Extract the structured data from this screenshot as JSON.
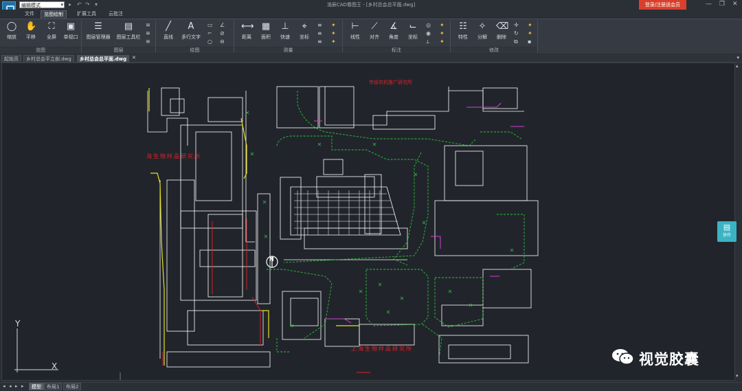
{
  "titlebar": {
    "mode_select": "编辑模式",
    "app_title": "浩辰CAD看图王 - [乡村总会总平面.dwg]",
    "login_button": "登录/注册送会员",
    "win_min": "—",
    "win_restore": "❐",
    "win_close": "✕"
  },
  "menu": [
    "文件",
    "览图绘制",
    "扩展工具",
    "云批注"
  ],
  "ribbon": {
    "view": {
      "label": "览图",
      "buttons": [
        "缩放",
        "平移",
        "全屏",
        "单视口"
      ]
    },
    "layer": {
      "label": "图层",
      "buttons": [
        "图层管理器",
        "图层工具栏"
      ]
    },
    "draw": {
      "label": "绘图",
      "buttons": [
        "直线",
        "多行文字"
      ]
    },
    "measure": {
      "label": "测量",
      "buttons": [
        "距离",
        "面积",
        "快速",
        "坐标"
      ]
    },
    "annotate": {
      "label": "标注",
      "buttons": [
        "线性",
        "对齐",
        "角度",
        "坐标"
      ]
    },
    "modify": {
      "label": "修改",
      "buttons": [
        "特性",
        "分解",
        "删除"
      ]
    }
  },
  "doc_tabs": [
    "起始页",
    "乡村总会平立剖.dwg",
    "乡村总会总平面.dwg"
  ],
  "doc_close": "✕",
  "tabs_control": "▾",
  "drawing": {
    "labels_red": [
      "市级农机推广研究所",
      "海生物样品研究所",
      "上海生物样品研究所"
    ],
    "north_mark": "N"
  },
  "ucs": {
    "x": "X",
    "y": "Y"
  },
  "layout_tabs": [
    "模型",
    "布局1",
    "布局2"
  ],
  "nav_arrows": [
    "◂",
    "◂",
    "▸",
    "▸"
  ],
  "collab": {
    "label": "协作"
  },
  "watermark": {
    "text": "视觉胶囊"
  },
  "colors": {
    "login": "#d9402c",
    "collab": "#3bb3c3",
    "cad_green": "#2bc23a",
    "cad_red": "#e0202a",
    "cad_yellow": "#e8e21a",
    "cad_magenta": "#d040d0"
  }
}
